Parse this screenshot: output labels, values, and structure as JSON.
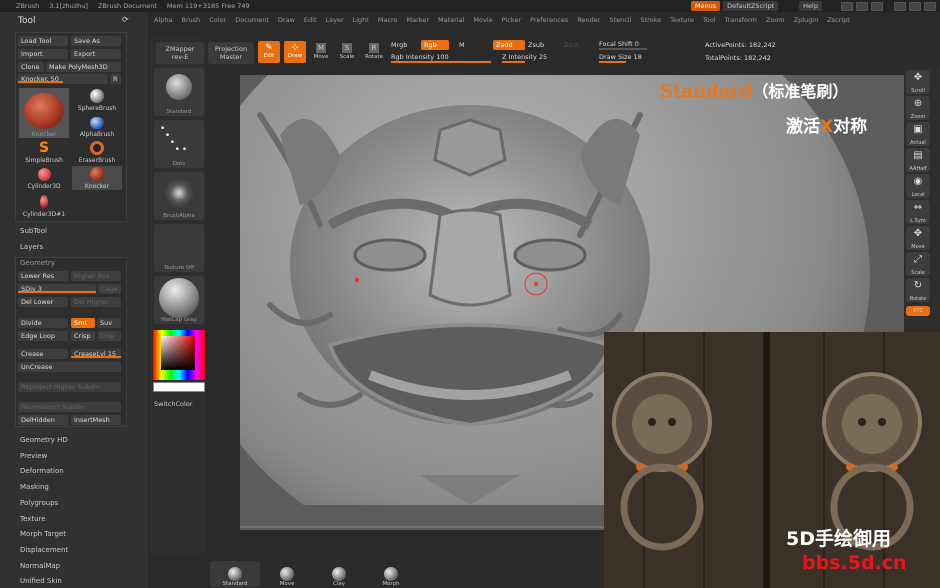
{
  "titlebar": {
    "app": "ZBrush",
    "version": "3.1[zhuzhu]",
    "document": "ZBrush Document",
    "mem": "Mem 119+3185 Free 749",
    "menus_btn": "Menus",
    "script_btn": "DefaultZScript",
    "help_btn": "Help"
  },
  "menubar": [
    "Alpha",
    "Brush",
    "Color",
    "Document",
    "Draw",
    "Edit",
    "Layer",
    "Light",
    "Macro",
    "Marker",
    "Material",
    "Movie",
    "Picker",
    "Preferences",
    "Render",
    "Stencil",
    "Stroke",
    "Texture",
    "Tool",
    "Transform",
    "Zoom",
    "Zplugin",
    "Zscript"
  ],
  "tool": {
    "title": "Tool",
    "load": "Load Tool",
    "save": "Save As",
    "import": "Import",
    "export": "Export",
    "clone": "Clone",
    "make_polymesh": "Make PolyMesh3D",
    "knocker_slider": "Knocker. 50",
    "r_btn": "R",
    "thumbs": [
      {
        "label": "Knocker"
      },
      {
        "label": "SphereBrush"
      },
      {
        "label": "AlphaBrush"
      },
      {
        "label": "SimpleBrush"
      },
      {
        "label": "EraserBrush"
      },
      {
        "label": "Cylinder3D"
      },
      {
        "label": "Knocker"
      },
      {
        "label": "Cylinder3D#1"
      }
    ],
    "subtool": "SubTool",
    "layers": "Layers",
    "geometry": "Geometry",
    "lower_res": "Lower Res",
    "higher_res": "Higher Res",
    "sdiv": "SDiv 3",
    "cage": "Cage",
    "del_lower": "Del Lower",
    "del_higher": "Del Higher",
    "divide": "Divide",
    "smt": "Smt",
    "suv": "Suv",
    "edge_loop": "Edge Loop",
    "crisp": "Crisp",
    "disp": "Disp",
    "crease": "Crease",
    "crease_lvl": "CreaseLvl 15",
    "uncrease": "UnCrease",
    "reproject": "Reproject Higher Subdiv",
    "reconstruct": "Reconstruct Subdiv",
    "delhidden": "DelHidden",
    "insertmesh": "InsertMesh",
    "sections": [
      "Geometry HD",
      "Preview",
      "Deformation",
      "Masking",
      "Polygroups",
      "Texture",
      "Morph Target",
      "Displacement",
      "NormalMap",
      "Unified Skin"
    ]
  },
  "shelf": {
    "items": [
      "Standard",
      "Dots",
      "BrushAlpha",
      "Texture Off",
      "MatCap Gray"
    ],
    "switch_color": "SwitchColor"
  },
  "topshelf": {
    "zmapper": "ZMapper",
    "zmapper_rev": "rev-E",
    "projection": "Projection",
    "projection_master": "Master",
    "edit": "Edit",
    "draw": "Draw",
    "move": "Move",
    "scale": "Scale",
    "rotate": "Rotate",
    "mrgb": "Mrgb",
    "rgb": "Rgb",
    "m": "M",
    "rgb_intensity": "Rgb Intensity 100",
    "zadd": "Zadd",
    "zsub": "Zsub",
    "zcut": "Zcut",
    "z_intensity": "Z Intensity 25",
    "focal_shift": "Focal Shift 0",
    "draw_size": "Draw Size 18",
    "active_points": "ActivePoints: 182,242",
    "total_points": "TotalPoints: 182,242"
  },
  "rightshelf": [
    "Scroll",
    "Zoom",
    "Actual",
    "AAHalf",
    "Local",
    "L.Sym",
    "Move",
    "Scale",
    "Rotate",
    "XYZ"
  ],
  "bottom": [
    "Standard",
    "Move",
    "Clay",
    "Morph"
  ],
  "overlay": {
    "title_en": "Standard",
    "title_cn": "（标准笔刷）",
    "subtitle_a": "激活",
    "subtitle_x": "X",
    "subtitle_b": "对称",
    "wm1": "5D手绘御用",
    "wm2": "bbs.5d.cn"
  },
  "colors": {
    "accent": "#e87010",
    "panel": "#313131",
    "canvas": "#5e5e5e"
  }
}
